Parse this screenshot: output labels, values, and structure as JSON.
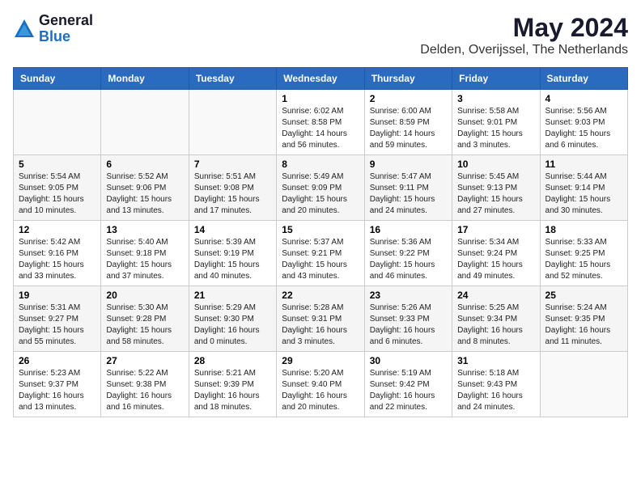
{
  "logo": {
    "general": "General",
    "blue": "Blue"
  },
  "title": {
    "month_year": "May 2024",
    "location": "Delden, Overijssel, The Netherlands"
  },
  "days_of_week": [
    "Sunday",
    "Monday",
    "Tuesday",
    "Wednesday",
    "Thursday",
    "Friday",
    "Saturday"
  ],
  "weeks": [
    [
      {
        "day": "",
        "info": ""
      },
      {
        "day": "",
        "info": ""
      },
      {
        "day": "",
        "info": ""
      },
      {
        "day": "1",
        "info": "Sunrise: 6:02 AM\nSunset: 8:58 PM\nDaylight: 14 hours and 56 minutes."
      },
      {
        "day": "2",
        "info": "Sunrise: 6:00 AM\nSunset: 8:59 PM\nDaylight: 14 hours and 59 minutes."
      },
      {
        "day": "3",
        "info": "Sunrise: 5:58 AM\nSunset: 9:01 PM\nDaylight: 15 hours and 3 minutes."
      },
      {
        "day": "4",
        "info": "Sunrise: 5:56 AM\nSunset: 9:03 PM\nDaylight: 15 hours and 6 minutes."
      }
    ],
    [
      {
        "day": "5",
        "info": "Sunrise: 5:54 AM\nSunset: 9:05 PM\nDaylight: 15 hours and 10 minutes."
      },
      {
        "day": "6",
        "info": "Sunrise: 5:52 AM\nSunset: 9:06 PM\nDaylight: 15 hours and 13 minutes."
      },
      {
        "day": "7",
        "info": "Sunrise: 5:51 AM\nSunset: 9:08 PM\nDaylight: 15 hours and 17 minutes."
      },
      {
        "day": "8",
        "info": "Sunrise: 5:49 AM\nSunset: 9:09 PM\nDaylight: 15 hours and 20 minutes."
      },
      {
        "day": "9",
        "info": "Sunrise: 5:47 AM\nSunset: 9:11 PM\nDaylight: 15 hours and 24 minutes."
      },
      {
        "day": "10",
        "info": "Sunrise: 5:45 AM\nSunset: 9:13 PM\nDaylight: 15 hours and 27 minutes."
      },
      {
        "day": "11",
        "info": "Sunrise: 5:44 AM\nSunset: 9:14 PM\nDaylight: 15 hours and 30 minutes."
      }
    ],
    [
      {
        "day": "12",
        "info": "Sunrise: 5:42 AM\nSunset: 9:16 PM\nDaylight: 15 hours and 33 minutes."
      },
      {
        "day": "13",
        "info": "Sunrise: 5:40 AM\nSunset: 9:18 PM\nDaylight: 15 hours and 37 minutes."
      },
      {
        "day": "14",
        "info": "Sunrise: 5:39 AM\nSunset: 9:19 PM\nDaylight: 15 hours and 40 minutes."
      },
      {
        "day": "15",
        "info": "Sunrise: 5:37 AM\nSunset: 9:21 PM\nDaylight: 15 hours and 43 minutes."
      },
      {
        "day": "16",
        "info": "Sunrise: 5:36 AM\nSunset: 9:22 PM\nDaylight: 15 hours and 46 minutes."
      },
      {
        "day": "17",
        "info": "Sunrise: 5:34 AM\nSunset: 9:24 PM\nDaylight: 15 hours and 49 minutes."
      },
      {
        "day": "18",
        "info": "Sunrise: 5:33 AM\nSunset: 9:25 PM\nDaylight: 15 hours and 52 minutes."
      }
    ],
    [
      {
        "day": "19",
        "info": "Sunrise: 5:31 AM\nSunset: 9:27 PM\nDaylight: 15 hours and 55 minutes."
      },
      {
        "day": "20",
        "info": "Sunrise: 5:30 AM\nSunset: 9:28 PM\nDaylight: 15 hours and 58 minutes."
      },
      {
        "day": "21",
        "info": "Sunrise: 5:29 AM\nSunset: 9:30 PM\nDaylight: 16 hours and 0 minutes."
      },
      {
        "day": "22",
        "info": "Sunrise: 5:28 AM\nSunset: 9:31 PM\nDaylight: 16 hours and 3 minutes."
      },
      {
        "day": "23",
        "info": "Sunrise: 5:26 AM\nSunset: 9:33 PM\nDaylight: 16 hours and 6 minutes."
      },
      {
        "day": "24",
        "info": "Sunrise: 5:25 AM\nSunset: 9:34 PM\nDaylight: 16 hours and 8 minutes."
      },
      {
        "day": "25",
        "info": "Sunrise: 5:24 AM\nSunset: 9:35 PM\nDaylight: 16 hours and 11 minutes."
      }
    ],
    [
      {
        "day": "26",
        "info": "Sunrise: 5:23 AM\nSunset: 9:37 PM\nDaylight: 16 hours and 13 minutes."
      },
      {
        "day": "27",
        "info": "Sunrise: 5:22 AM\nSunset: 9:38 PM\nDaylight: 16 hours and 16 minutes."
      },
      {
        "day": "28",
        "info": "Sunrise: 5:21 AM\nSunset: 9:39 PM\nDaylight: 16 hours and 18 minutes."
      },
      {
        "day": "29",
        "info": "Sunrise: 5:20 AM\nSunset: 9:40 PM\nDaylight: 16 hours and 20 minutes."
      },
      {
        "day": "30",
        "info": "Sunrise: 5:19 AM\nSunset: 9:42 PM\nDaylight: 16 hours and 22 minutes."
      },
      {
        "day": "31",
        "info": "Sunrise: 5:18 AM\nSunset: 9:43 PM\nDaylight: 16 hours and 24 minutes."
      },
      {
        "day": "",
        "info": ""
      }
    ]
  ]
}
